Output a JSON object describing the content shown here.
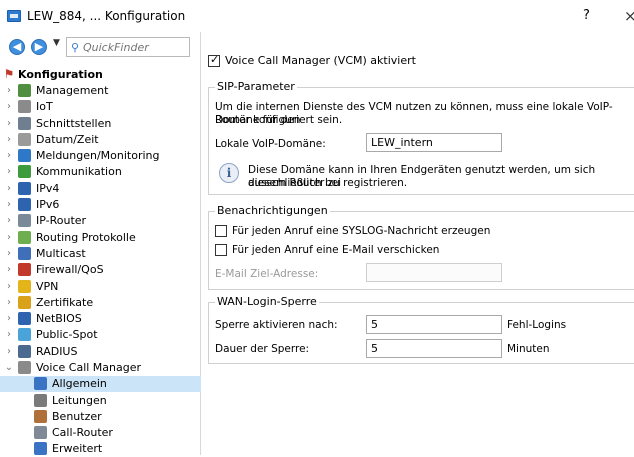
{
  "window": {
    "title": "LEW_884, ... Konfiguration",
    "help_label": "?",
    "close_label": "×"
  },
  "nav": {
    "back_glyph": "◀",
    "forward_glyph": "▶",
    "dropdown_glyph": "▼",
    "search_placeholder": "QuickFinder"
  },
  "tree": {
    "root": "Konfiguration",
    "items": [
      {
        "label": "Management",
        "color": "#4f8f3f"
      },
      {
        "label": "IoT",
        "color": "#8b8b8b"
      },
      {
        "label": "Schnittstellen",
        "color": "#6f7f8f"
      },
      {
        "label": "Datum/Zeit",
        "color": "#9a9a9a"
      },
      {
        "label": "Meldungen/Monitoring",
        "color": "#2f78c8"
      },
      {
        "label": "Kommunikation",
        "color": "#3d9b3d"
      },
      {
        "label": "IPv4",
        "color": "#2e63b0"
      },
      {
        "label": "IPv6",
        "color": "#2e63b0"
      },
      {
        "label": "IP-Router",
        "color": "#7a8a99"
      },
      {
        "label": "Routing Protokolle",
        "color": "#6fae4f"
      },
      {
        "label": "Multicast",
        "color": "#3f6fb8"
      },
      {
        "label": "Firewall/QoS",
        "color": "#c0392b"
      },
      {
        "label": "VPN",
        "color": "#e3b51a"
      },
      {
        "label": "Zertifikate",
        "color": "#d9a21a"
      },
      {
        "label": "NetBIOS",
        "color": "#2e63b0"
      },
      {
        "label": "Public-Spot",
        "color": "#4aa3d9"
      },
      {
        "label": "RADIUS",
        "color": "#4b6a8f"
      },
      {
        "label": "Voice Call Manager",
        "color": "#8a8a8a"
      }
    ],
    "children": [
      {
        "label": "Allgemein",
        "color": "#3a72c4",
        "selected": true
      },
      {
        "label": "Leitungen",
        "color": "#7a7a7a",
        "selected": false
      },
      {
        "label": "Benutzer",
        "color": "#b0703a",
        "selected": false
      },
      {
        "label": "Call-Router",
        "color": "#7f8a96",
        "selected": false
      },
      {
        "label": "Erweitert",
        "color": "#3a72c4",
        "selected": false
      }
    ]
  },
  "main": {
    "vcm_checkbox_label": "Voice Call Manager (VCM) aktiviert",
    "vcm_checked": true,
    "sip": {
      "title": "SIP-Parameter",
      "description_line1": "Um die internen Dienste des VCM nutzen zu können, muss eine lokale VoIP-Domäne für den",
      "description_line2": "Router konfiguriert sein.",
      "domain_label": "Lokale VoIP-Domäne:",
      "domain_value": "LEW_intern",
      "info_glyph": "i",
      "info_line1": "Diese Domäne kann in Ihren Endgeräten genutzt werden, um sich ausschließlich bei",
      "info_line2": "diesem Router zu registrieren."
    },
    "notifications": {
      "title": "Benachrichtigungen",
      "syslog_label": "Für jeden Anruf eine SYSLOG-Nachricht erzeugen",
      "email_label": "Für jeden Anruf eine E-Mail verschicken",
      "email_target_label": "E-Mail Ziel-Adresse:",
      "email_target_value": ""
    },
    "wan": {
      "title": "WAN-Login-Sperre",
      "activate_label": "Sperre aktivieren nach:",
      "activate_value": "5",
      "activate_unit": "Fehl-Logins",
      "duration_label": "Dauer der Sperre:",
      "duration_value": "5",
      "duration_unit": "Minuten"
    }
  }
}
